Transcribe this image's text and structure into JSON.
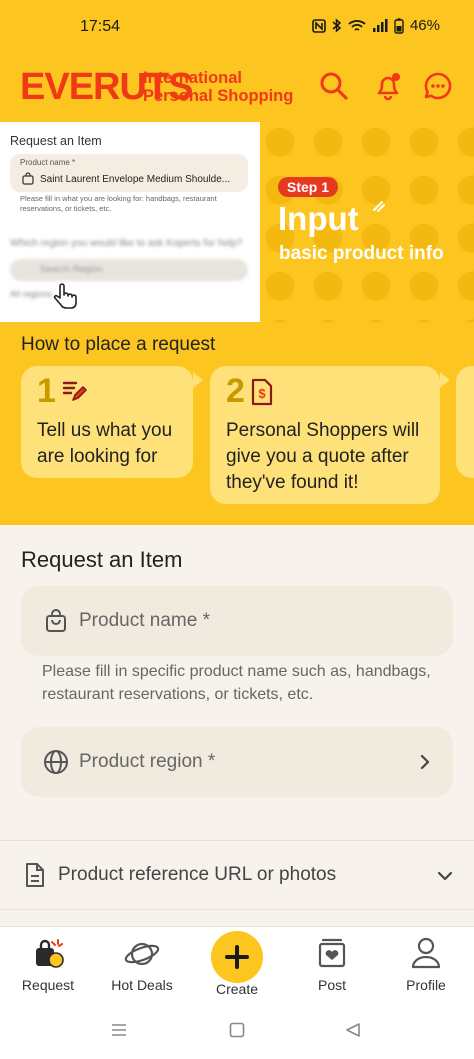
{
  "status_bar": {
    "time": "17:54",
    "battery": "46%"
  },
  "header": {
    "logo": "EVERUTS",
    "tagline_line1": "International",
    "tagline_line2": "Personal Shopping"
  },
  "banner": {
    "shot_title": "Request an Item",
    "shot_field_label": "Product name *",
    "shot_field_value": "Saint Laurent Envelope Medium Shoulde...",
    "shot_hint": "Please fill in what you are looking for: handbags, restaurant reservations, or tickets, etc.",
    "shot_blur_question": "Which region you would like to ask Koperts for help?",
    "shot_blur_placeholder": "Search Region",
    "shot_blur_popular": "All regions",
    "step_badge": "Step 1",
    "title": "Input",
    "subtitle": "basic product info"
  },
  "howto": {
    "title": "How to place a request",
    "steps": [
      {
        "num": "1",
        "text_line1": "Tell us what you",
        "text_line2": "are looking for"
      },
      {
        "num": "2",
        "text_line1": "Personal Shoppers will",
        "text_line2": "give you a quote after",
        "text_line3": "they've found it!"
      }
    ]
  },
  "form": {
    "title": "Request an Item",
    "product_name_placeholder": "Product name *",
    "product_name_hint": "Please fill in specific product name such as, handbags, restaurant reservations, or tickets, etc.",
    "region_placeholder": "Product region *",
    "reference_label": "Product reference URL or photos"
  },
  "tabbar": {
    "items": [
      {
        "label": "Request",
        "icon": "request-icon"
      },
      {
        "label": "Hot Deals",
        "icon": "planet-icon"
      },
      {
        "label": "Create",
        "icon": "plus-icon"
      },
      {
        "label": "Post",
        "icon": "post-icon"
      },
      {
        "label": "Profile",
        "icon": "profile-icon"
      }
    ]
  },
  "colors": {
    "brand_yellow": "#FDC51F",
    "brand_red": "#F03A17",
    "card_yellow": "#FFE17A",
    "background": "#F7F3EC"
  }
}
